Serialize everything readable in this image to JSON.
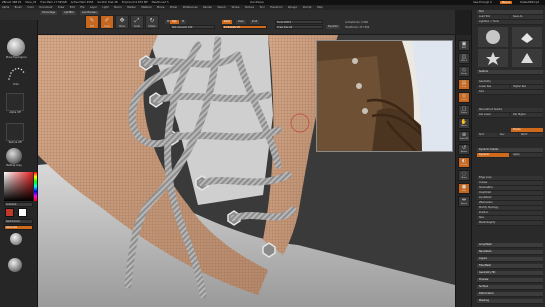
{
  "titlebar": {
    "app": "ZBrush 4R8 P2",
    "doc": "Shoe_03",
    "stats": "Free Mem 17.595GB",
    "stats2": "Active Mem 4554",
    "stats3": "Scratch Disk 48",
    "stats4": "PolyCount 0.879 MP",
    "stats5": "MeshCount 5",
    "quicksave": "QuickSave",
    "seethrough": "See-through 0",
    "menus": "Menus",
    "defaultscript": "DefaultZScript"
  },
  "menubar": [
    "Alpha",
    "Brush",
    "Color",
    "Document",
    "Draw",
    "Edit",
    "File",
    "Layer",
    "Light",
    "Macro",
    "Marker",
    "Material",
    "Movie",
    "Picker",
    "Preferences",
    "Render",
    "Stencil",
    "Stroke",
    "Texture",
    "Tool",
    "Transform",
    "Zplugin",
    "Zscript",
    "Help"
  ],
  "shelf": {
    "tabs": [
      "Home Page",
      "LightBox",
      "Live Boolean"
    ],
    "autosave": "Activate Dynamic Lambs",
    "tools": [
      "Edit",
      "Draw",
      "Move",
      "Scale",
      "Rotate"
    ],
    "mrgb": "Mrgb",
    "rgb": "Rgb",
    "m": "M",
    "rgb_intensity": "Rgb Intensity",
    "rgb_intensity_val": "100",
    "zadd": "Zadd",
    "zsub": "Zsub",
    "zcut": "Zcut",
    "focal_shift": "Focal Shift",
    "focal_shift_val": "0",
    "z_intensity": "Z Intensity",
    "z_intensity_val": "25",
    "draw_size": "Draw Size",
    "draw_size_val": "64",
    "dynamic": "Dynamic",
    "active_points": "ActivePoints: 2.866",
    "total_points": "TotalPoints: 477.484"
  },
  "leftpanel": {
    "brush_label": "Move Topological",
    "stroke_label": "Dots",
    "alpha_label": "Alpha Off",
    "texture_label": "Texture Off",
    "material_label": "MatCap Gray",
    "gradient_label": "Gradient",
    "switch_color": "SwitchColor",
    "alternate": "Alternate",
    "color_primary": "#c0392b",
    "color_secondary": "#ffffff"
  },
  "vtools": [
    "BPR",
    "SPix 3",
    "Persp",
    "Floor",
    "Local",
    "Frame",
    "Move",
    "Zoom3D",
    "Rotate",
    "Transp",
    "Ghost",
    "Solo",
    "Xpose"
  ],
  "rightpanel": {
    "header": "Tool",
    "load": "Load Tool",
    "save": "Save As",
    "lightbox": "Lightbox > Tools",
    "current": "Shoe_03.ztl",
    "r_value": "R",
    "subtools": [
      "Subtool",
      "Geometry",
      "Lower Res",
      "Higher Res",
      "Sdiv",
      "Reconstruct Subdiv",
      "Del Lower",
      "Del Higher",
      "Divide",
      "Smt",
      "Suv",
      "ReUV",
      "Dynamic Subdiv",
      "Dynamic",
      "Apply",
      "Edge Loop",
      "Crease",
      "ShadowBox",
      "ClayPolish",
      "DynaMesh",
      "ZRemesher",
      "Modify Topology",
      "Position",
      "Size",
      "MeshIntegrity"
    ],
    "bottom": [
      "ArrayMesh",
      "NanoMesh",
      "Layers",
      "FiberMesh",
      "Geometry HD",
      "Preview",
      "Surface",
      "Deformation",
      "Masking"
    ]
  }
}
